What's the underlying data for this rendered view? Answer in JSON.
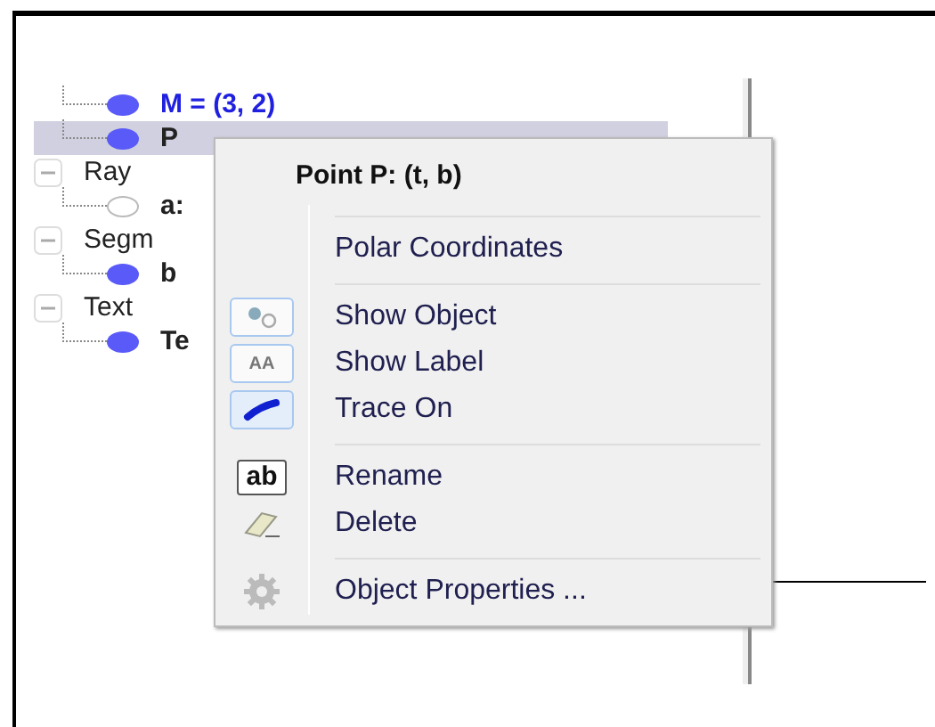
{
  "tree": [
    {
      "kind": "item",
      "label": "M = (3, 2)",
      "shown": true,
      "highlighted": true,
      "selected": false
    },
    {
      "kind": "item",
      "label": "P",
      "shown": true,
      "highlighted": false,
      "selected": true
    },
    {
      "kind": "group",
      "label": "Ray",
      "expanded": true,
      "children": [
        {
          "kind": "item",
          "label": "a:",
          "shown": false,
          "highlighted": false,
          "selected": false
        }
      ]
    },
    {
      "kind": "group",
      "label": "Segm",
      "expanded": true,
      "children": [
        {
          "kind": "item",
          "label": "b",
          "shown": true,
          "highlighted": false,
          "selected": false
        }
      ]
    },
    {
      "kind": "group",
      "label": "Text",
      "expanded": true,
      "children": [
        {
          "kind": "item",
          "label": "Te",
          "shown": true,
          "highlighted": false,
          "selected": false
        }
      ]
    }
  ],
  "menu": {
    "title": "Point P: (t, b)",
    "items": [
      {
        "kind": "separator"
      },
      {
        "kind": "plain",
        "label": "Polar Coordinates"
      },
      {
        "kind": "separator"
      },
      {
        "kind": "show-object",
        "label": "Show Object",
        "checked": true
      },
      {
        "kind": "show-label",
        "label": "Show Label",
        "checked": true,
        "glyph": "AA"
      },
      {
        "kind": "trace",
        "label": "Trace On",
        "checked": true
      },
      {
        "kind": "separator"
      },
      {
        "kind": "rename",
        "label": "Rename",
        "glyph": "ab"
      },
      {
        "kind": "delete",
        "label": "Delete"
      },
      {
        "kind": "separator"
      },
      {
        "kind": "properties",
        "label": "Object Properties ..."
      }
    ]
  }
}
